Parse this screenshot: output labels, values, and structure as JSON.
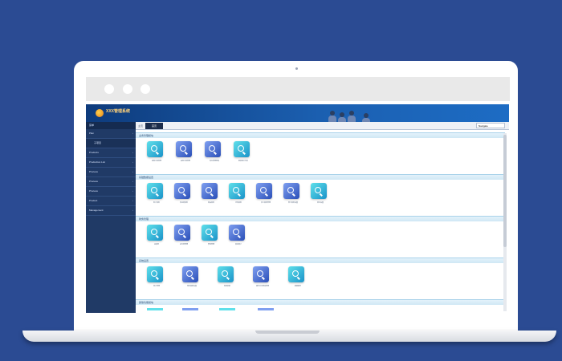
{
  "app": {
    "title": "XXX管理系统",
    "sidebar_head": "菜单",
    "sidebar_items": [
      {
        "label": "Plan",
        "sub": false
      },
      {
        "label": "子项目",
        "sub": true
      },
      {
        "label": "Products",
        "sub": false
      },
      {
        "label": "Production List",
        "sub": false
      },
      {
        "label": "Process",
        "sub": false
      },
      {
        "label": "Process",
        "sub": false
      },
      {
        "label": "Process",
        "sub": false
      },
      {
        "label": "Product",
        "sub": false
      },
      {
        "label": "Management",
        "sub": false
      }
    ],
    "tabs": {
      "home_label": "主页",
      "active_label": "首页",
      "right_label": "Navigate"
    },
    "sections": [
      {
        "title": "业务管理模块",
        "icons": [
          {
            "label": "销售订单管理",
            "color": "cyan"
          },
          {
            "label": "采购订单管理",
            "color": "blue"
          },
          {
            "label": "库存管理查询",
            "color": "blue"
          },
          {
            "label": "报表统计分析",
            "color": "cyan"
          }
        ]
      },
      {
        "title": "基础数据设置",
        "icons": [
          {
            "label": "客户资料",
            "color": "cyan"
          },
          {
            "label": "供应商资料",
            "color": "blue"
          },
          {
            "label": "商品资料",
            "color": "blue"
          },
          {
            "label": "仓库资料",
            "color": "cyan"
          },
          {
            "label": "员工资料管理",
            "color": "blue"
          },
          {
            "label": "部门资料设置",
            "color": "blue"
          },
          {
            "label": "单位设置",
            "color": "cyan"
          }
        ]
      },
      {
        "title": "财务管理",
        "icons": [
          {
            "label": "应收款",
            "color": "cyan"
          },
          {
            "label": "应付款管理",
            "color": "blue"
          },
          {
            "label": "费用管理",
            "color": "cyan"
          },
          {
            "label": "资金账户",
            "color": "blue"
          }
        ]
      },
      {
        "title": "系统设置",
        "icons": [
          {
            "label": "用户管理",
            "color": "cyan"
          },
          {
            "label": "角色权限设置",
            "color": "blue"
          },
          {
            "label": "系统参数",
            "color": "cyan"
          },
          {
            "label": "操作日志查询管理",
            "color": "blue"
          },
          {
            "label": "数据备份",
            "color": "cyan"
          }
        ]
      },
      {
        "title": "其他功能模块",
        "icons": []
      }
    ],
    "colors": {
      "background": "#2b4b93",
      "header": "#1b5fb0",
      "sidebar": "#203a66",
      "accent_cyan": "#1a93c9",
      "accent_blue": "#2a4fb8"
    }
  }
}
